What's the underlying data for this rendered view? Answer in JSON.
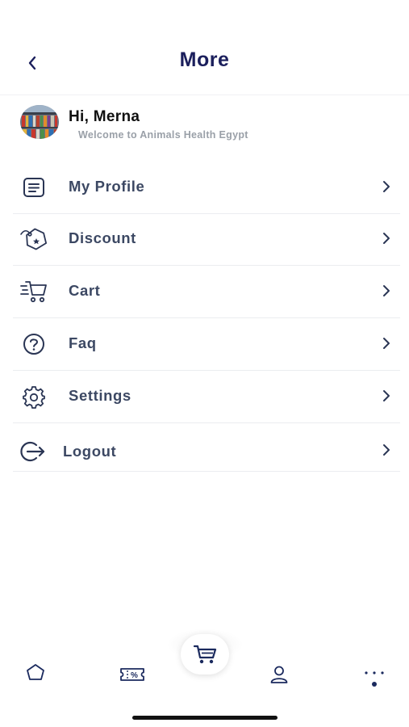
{
  "header": {
    "title": "More"
  },
  "profile": {
    "greeting": "Hi, Merna",
    "welcome": "Welcome to Animals Health Egypt"
  },
  "menu": {
    "items": [
      {
        "label": "My Profile",
        "icon": "document-icon"
      },
      {
        "label": "Discount",
        "icon": "discount-tag-icon"
      },
      {
        "label": "Cart",
        "icon": "cart-icon"
      },
      {
        "label": "Faq",
        "icon": "question-circle-icon"
      },
      {
        "label": "Settings",
        "icon": "gear-icon"
      },
      {
        "label": "Logout",
        "icon": "logout-icon"
      }
    ]
  },
  "tabbar": {
    "tabs": [
      "home-icon",
      "coupon-icon",
      "cart-icon",
      "person-icon",
      "more-dots-icon"
    ],
    "active": "more-dots-icon"
  },
  "colors": {
    "title": "#1b1f5c",
    "label": "#3c4863",
    "icon": "#2a3554",
    "accent": "#1b2a5e"
  }
}
